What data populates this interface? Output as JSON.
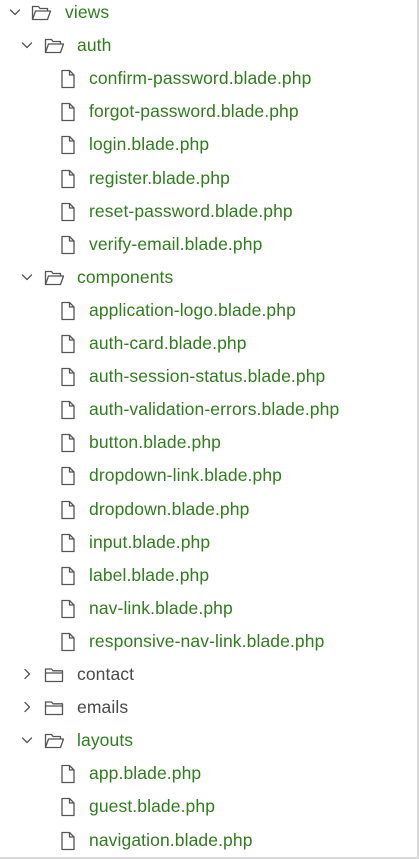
{
  "colors": {
    "changed_text": "#2f7d1d",
    "default_text": "#4a4a4a",
    "icon_stroke": "#555555"
  },
  "tree": {
    "views": {
      "label": "views",
      "icon": "folder-open-icon",
      "expanded": true
    },
    "auth": {
      "label": "auth",
      "icon": "folder-open-icon",
      "expanded": true,
      "files": [
        "confirm-password.blade.php",
        "forgot-password.blade.php",
        "login.blade.php",
        "register.blade.php",
        "reset-password.blade.php",
        "verify-email.blade.php"
      ]
    },
    "components": {
      "label": "components",
      "icon": "folder-open-icon",
      "expanded": true,
      "files": [
        "application-logo.blade.php",
        "auth-card.blade.php",
        "auth-session-status.blade.php",
        "auth-validation-errors.blade.php",
        "button.blade.php",
        "dropdown-link.blade.php",
        "dropdown.blade.php",
        "input.blade.php",
        "label.blade.php",
        "nav-link.blade.php",
        "responsive-nav-link.blade.php"
      ]
    },
    "contact": {
      "label": "contact",
      "icon": "folder-closed-icon",
      "expanded": false
    },
    "emails": {
      "label": "emails",
      "icon": "folder-closed-icon",
      "expanded": false
    },
    "layouts": {
      "label": "layouts",
      "icon": "folder-open-icon",
      "expanded": true,
      "files": [
        "app.blade.php",
        "guest.blade.php",
        "navigation.blade.php"
      ]
    }
  }
}
